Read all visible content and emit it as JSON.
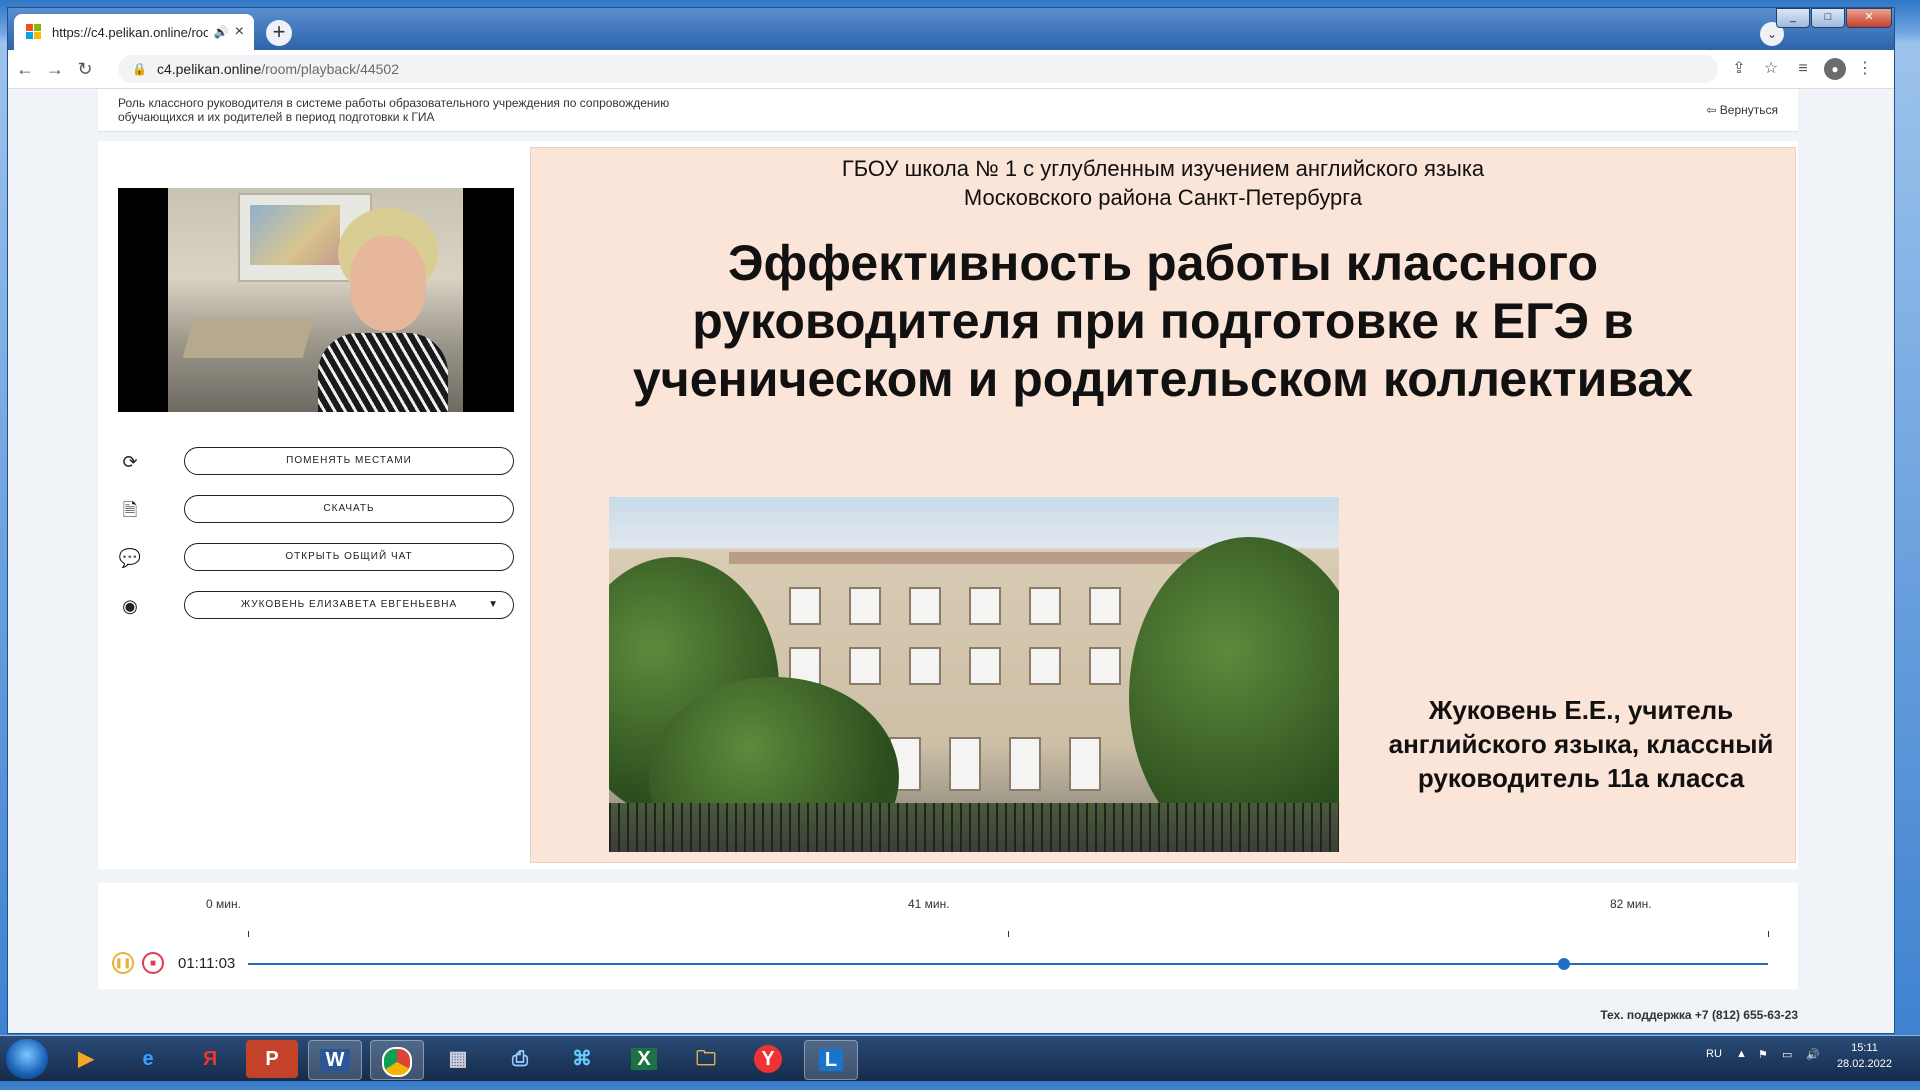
{
  "browser": {
    "tab_title": "https://c4.pelikan.online/roo",
    "tab_mute_icon": "speaker-icon",
    "url_host": "c4.pelikan.online",
    "url_path": "/room/playback/44502"
  },
  "header": {
    "course_title": "Роль классного руководителя в системе работы образовательного учреждения по сопровождению обучающихся и их родителей в период подготовки к ГИА",
    "back_label": "Вернуться"
  },
  "controls": {
    "swap_label": "ПОМЕНЯТЬ МЕСТАМИ",
    "download_label": "СКАЧАТЬ",
    "chat_label": "ОТКРЫТЬ ОБЩИЙ ЧАТ",
    "speaker_label": "ЖУКОВЕНЬ ЕЛИЗАВЕТА ЕВГЕНЬЕВНА"
  },
  "slide": {
    "school": "ГБОУ школа № 1 с углубленным изучением английского языка\nМосковского района Санкт-Петербурга",
    "title": "Эффективность работы классного руководителя при подготовке к ЕГЭ в ученическом и родительском коллективах",
    "author": "Жуковень Е.Е., учитель английского языка, классный руководитель 11а класса"
  },
  "timeline": {
    "tick_start": "0 мин.",
    "tick_mid": "41 мин.",
    "tick_end": "82 мин.",
    "current_time": "01:11:03",
    "progress": 0.866
  },
  "footer": {
    "support": "Тех. поддержка +7 (812) 655-63-23"
  },
  "taskbar": {
    "lang": "RU",
    "time": "15:11",
    "date": "28.02.2022"
  },
  "colors": {
    "slide_bg": "#fbe4d8",
    "progress": "#1f6fc4",
    "pause": "#e8b23a",
    "stop": "#e03a55"
  }
}
